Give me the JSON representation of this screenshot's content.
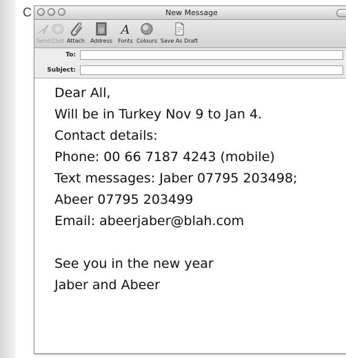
{
  "panel_letter": "C",
  "window": {
    "title": "New Message"
  },
  "toolbar": {
    "send_label": "Send",
    "chat_label": "Chat",
    "attach_label": "Attach",
    "address_label": "Address",
    "fonts_label": "Fonts",
    "colours_label": "Colours",
    "save_as_draft_label": "Save As Draft"
  },
  "header": {
    "to_label": "To:",
    "to_value": "",
    "subject_label": "Subject:",
    "subject_value": ""
  },
  "body": {
    "lines": [
      "Dear All,",
      "Will be in Turkey Nov 9 to Jan 4.",
      "Contact details:",
      "Phone: 00 66 7187 4243 (mobile)",
      "Text messages: Jaber 07795 203498;",
      "Abeer 07795 203499",
      "Email: abeerjaber@blah.com",
      "",
      "See you in the new year",
      "Jaber and Abeer"
    ]
  },
  "colors": {
    "window_border": "#8b8b8b",
    "toolbar_bg": "#dedede",
    "text": "#111111"
  }
}
